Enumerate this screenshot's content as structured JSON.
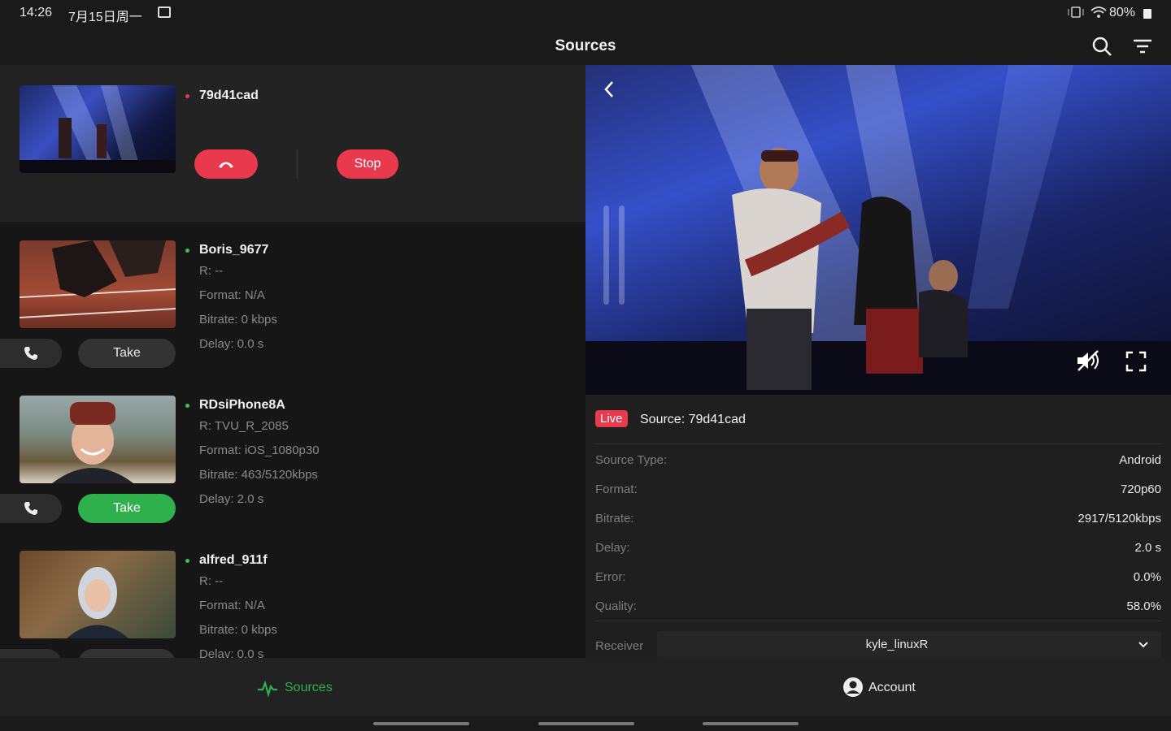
{
  "status": {
    "time": "14:26",
    "date": "7月15日周一",
    "battery": "80%"
  },
  "header": {
    "title": "Sources"
  },
  "active": {
    "name": "79d41cad",
    "stop_label": "Stop"
  },
  "sources": [
    {
      "name": "Boris_9677",
      "r": "R: --",
      "format": "Format: N/A",
      "bitrate": "Bitrate: 0 kbps",
      "delay": "Delay: 0.0 s",
      "take_label": "Take"
    },
    {
      "name": "RDsiPhone8A",
      "r": "R: TVU_R_2085",
      "format": "Format: iOS_1080p30",
      "bitrate": "Bitrate: 463/5120kbps",
      "delay": "Delay: 2.0 s",
      "take_label": "Take"
    },
    {
      "name": "alfred_911f",
      "r": "R: --",
      "format": "Format: N/A",
      "bitrate": "Bitrate: 0 kbps",
      "delay": "Delay: 0.0 s"
    }
  ],
  "detail": {
    "live_badge": "Live",
    "source_title": "Source: 79d41cad",
    "rows": [
      {
        "label": "Source Type:",
        "value": "Android"
      },
      {
        "label": "Format:",
        "value": "720p60"
      },
      {
        "label": "Bitrate:",
        "value": "2917/5120kbps"
      },
      {
        "label": "Delay:",
        "value": "2.0 s"
      },
      {
        "label": "Error:",
        "value": "0.0%"
      },
      {
        "label": "Quality:",
        "value": "58.0%"
      }
    ],
    "receiver_label": "Receiver",
    "receiver_value": "kyle_linuxR"
  },
  "nav": {
    "sources": "Sources",
    "account": "Account"
  },
  "colors": {
    "accent_red": "#e8394d",
    "accent_green": "#2eb04d",
    "status_green": "#3ac25a"
  }
}
